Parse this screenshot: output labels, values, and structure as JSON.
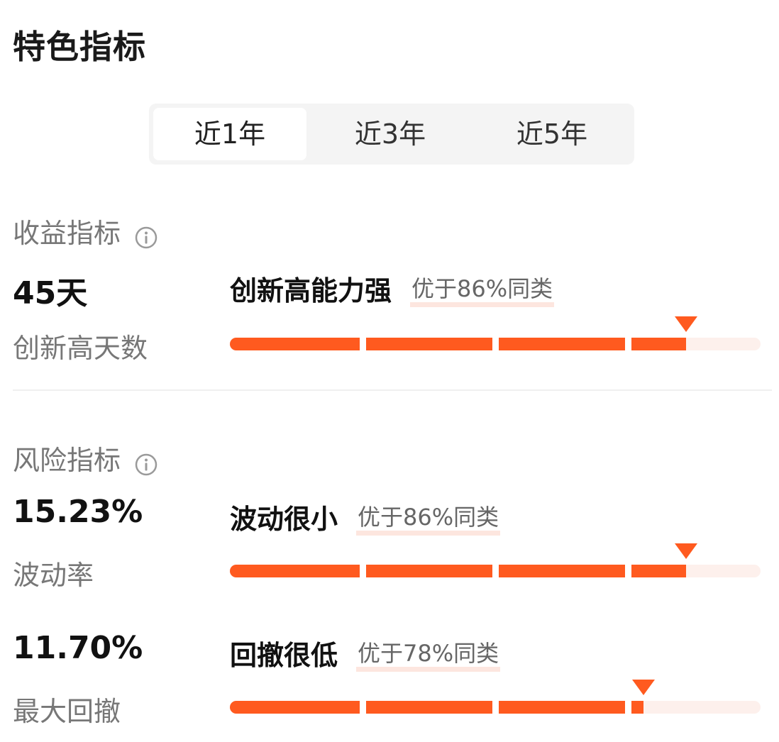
{
  "page": {
    "title": "特色指标"
  },
  "period_tabs": [
    {
      "label": "近1年",
      "active": true
    },
    {
      "label": "近3年",
      "active": false
    },
    {
      "label": "近5年",
      "active": false
    }
  ],
  "return_section": {
    "title": "收益指标",
    "icon": "info-icon",
    "metrics": [
      {
        "value": "45天",
        "label": "创新高天数",
        "rating": "创新高能力强",
        "rank": "优于86%同类",
        "percentile": 86
      }
    ]
  },
  "risk_section": {
    "title": "风险指标",
    "icon": "info-icon",
    "metrics": [
      {
        "value": "15.23%",
        "label": "波动率",
        "rating": "波动很小",
        "rank": "优于86%同类",
        "percentile": 86
      },
      {
        "value": "11.70%",
        "label": "最大回撤",
        "rating": "回撤很低",
        "rank": "优于78%同类",
        "percentile": 78
      }
    ]
  },
  "colors": {
    "accent": "#ff5a1f",
    "track": "#fdf0ec",
    "rank_highlight": "#fde6df"
  }
}
